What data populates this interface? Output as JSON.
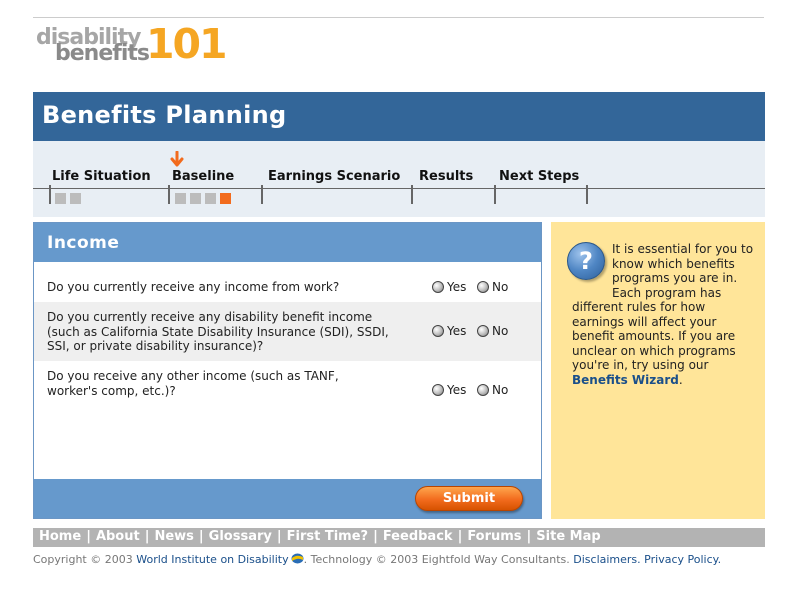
{
  "logo": {
    "word1": "disability",
    "word2": "benefits",
    "number": "101"
  },
  "header": {
    "title": "Benefits Planning"
  },
  "steps": [
    {
      "label": "Life Situation"
    },
    {
      "label": "Baseline"
    },
    {
      "label": "Earnings Scenario"
    },
    {
      "label": "Results"
    },
    {
      "label": "Next Steps"
    }
  ],
  "income": {
    "title": "Income",
    "questions": [
      {
        "text": "Do you currently receive any income from work?",
        "yes": "Yes",
        "no": "No"
      },
      {
        "text": "Do you currently receive any disability benefit income (such as California State Disability Insurance (SDI), SSDI, SSI, or private disability insurance)?",
        "yes": "Yes",
        "no": "No"
      },
      {
        "text": "Do you receive any other income (such as TANF, worker's comp, etc.)?",
        "yes": "Yes",
        "no": "No"
      }
    ],
    "submit_label": "Submit"
  },
  "info": {
    "text": "It is essential for you to know which benefits programs you are in. Each program has different rules for how earnings will affect your benefit amounts. If you are unclear on which programs you're in, try using our",
    "link": "Benefits Wizard",
    "tail": "."
  },
  "nav": {
    "items": [
      "Home",
      "About",
      "News",
      "Glossary",
      "First Time?",
      "Feedback",
      "Forums",
      "Site Map"
    ],
    "separator": "|"
  },
  "footer": {
    "copyright_prefix": "Copyright © 2003",
    "org_link": "World Institute on Disability",
    "technology": ". Technology © 2003 Eightfold Way Consultants.",
    "disclaimers": "Disclaimers.",
    "privacy": "Privacy Policy."
  },
  "colors": {
    "header_blue": "#336699",
    "panel_blue": "#6699cc",
    "accent_orange": "#f26b1d",
    "logo_orange": "#f5a623",
    "info_yellow": "#ffe599",
    "nav_gray": "#b3b3b3"
  }
}
